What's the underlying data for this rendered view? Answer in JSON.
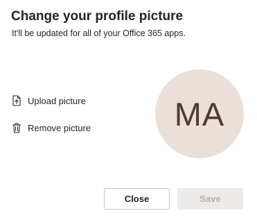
{
  "dialog": {
    "title": "Change your profile picture",
    "subtitle": "It'll be updated for all of your Office 365 apps."
  },
  "actions": {
    "upload": {
      "label": "Upload picture",
      "icon": "upload-file-icon"
    },
    "remove": {
      "label": "Remove picture",
      "icon": "trash-icon"
    }
  },
  "avatar": {
    "initials": "MA",
    "background": "#eadfd9",
    "color": "#4e3b32"
  },
  "buttons": {
    "close_label": "Close",
    "save_label": "Save",
    "save_disabled": true
  }
}
